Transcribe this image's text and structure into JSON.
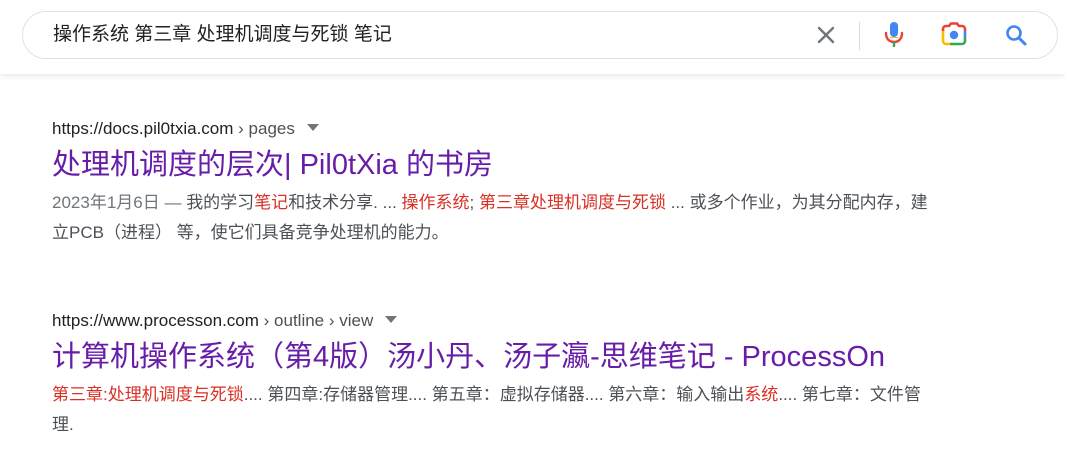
{
  "search": {
    "query": "操作系统 第三章 处理机调度与死锁 笔记"
  },
  "results": [
    {
      "site": "https://docs.pil0txia.com",
      "path": " › pages",
      "title": "处理机调度的层次| Pil0tXia 的书房",
      "snippet": [
        {
          "text": "2023年1月6日 — ",
          "style": "date"
        },
        {
          "text": "我的学习",
          "style": ""
        },
        {
          "text": "笔记",
          "style": "hl"
        },
        {
          "text": "和技术分享. ... ",
          "style": ""
        },
        {
          "text": "操作系统",
          "style": "hl"
        },
        {
          "text": "; ",
          "style": ""
        },
        {
          "text": "第三章处理机调度与死锁",
          "style": "hl"
        },
        {
          "text": " ... 或多个作业，为其分配内存，建立PCB（进程） 等，使它们具备竞争处理机的能力。",
          "style": ""
        }
      ]
    },
    {
      "site": "https://www.processon.com",
      "path": " › outline › view",
      "title": "计算机操作系统（第4版）汤小丹、汤子瀛-思维笔记 - ProcessOn",
      "snippet": [
        {
          "text": "第三章:处理机调度与死锁",
          "style": "hl"
        },
        {
          "text": ".... 第四章:存储器管理.... 第五章：虚拟存储器.... 第六章：输入输出",
          "style": ""
        },
        {
          "text": "系统",
          "style": "hl"
        },
        {
          "text": ".... 第七章：文件管理.",
          "style": ""
        }
      ]
    }
  ],
  "colors": {
    "title_visited": "#681da8",
    "highlight": "#d93025",
    "snippet": "#4d5156",
    "mic_blue": "#4285f4",
    "mic_red": "#ea4335",
    "search_blue": "#4285f4"
  },
  "icons": {
    "clear": "close-icon",
    "voice": "microphone-icon",
    "image": "camera-lens-icon",
    "search": "search-icon"
  }
}
